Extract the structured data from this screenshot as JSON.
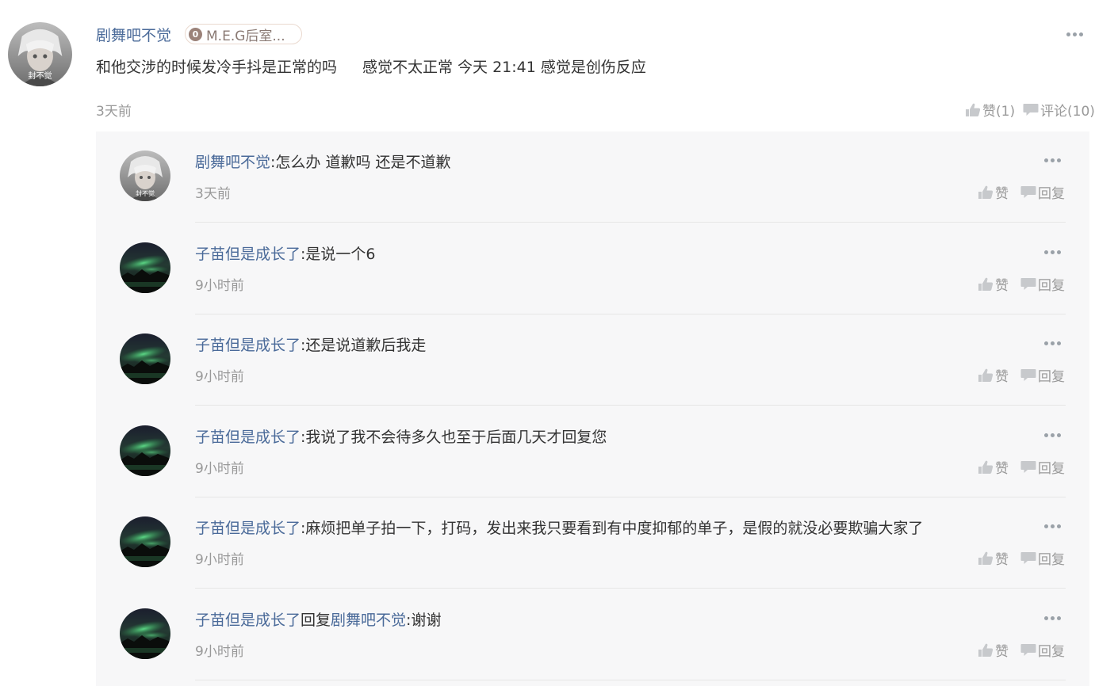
{
  "post": {
    "author": "剧舞吧不觉",
    "badge": {
      "level": "0",
      "name": "M.E.G后室..."
    },
    "content_main": "和他交涉的时候发冷手抖是正常的吗",
    "content_follow": "感觉不太正常 今天 21:41 感觉是创伤反应",
    "time": "3天前",
    "like_label": "赞(1)",
    "comment_label": "评论(10)",
    "avatar_text": "封不觉"
  },
  "comment_actions": {
    "like": "赞",
    "reply": "回复"
  },
  "comments": [
    {
      "user": "剧舞吧不觉",
      "reply_word": "",
      "reply_to": "",
      "sep": ":",
      "text": "怎么办 道歉吗 还是不道歉",
      "time": "3天前",
      "avatar_text": "封不觉",
      "avatar": "anime"
    },
    {
      "user": "子苗但是成长了",
      "reply_word": "",
      "reply_to": "",
      "sep": ":",
      "text": "是说一个6",
      "time": "9小时前",
      "avatar": "aurora"
    },
    {
      "user": "子苗但是成长了",
      "reply_word": "",
      "reply_to": "",
      "sep": ":",
      "text": "还是说道歉后我走",
      "time": "9小时前",
      "avatar": "aurora"
    },
    {
      "user": "子苗但是成长了",
      "reply_word": "",
      "reply_to": "",
      "sep": ":",
      "text": "我说了我不会待多久也至于后面几天才回复您",
      "time": "9小时前",
      "avatar": "aurora"
    },
    {
      "user": "子苗但是成长了",
      "reply_word": "",
      "reply_to": "",
      "sep": ":",
      "text": "麻烦把单子拍一下，打码，发出来我只要看到有中度抑郁的单子，是假的就没必要欺骗大家了",
      "time": "9小时前",
      "avatar": "aurora"
    },
    {
      "user": "子苗但是成长了",
      "reply_word": "回复",
      "reply_to": "剧舞吧不觉",
      "sep": ":",
      "text": "谢谢",
      "time": "9小时前",
      "avatar": "aurora"
    }
  ],
  "colors": {
    "link": "#4a6a99",
    "meta": "#999999",
    "panel": "#f7f7f8"
  }
}
